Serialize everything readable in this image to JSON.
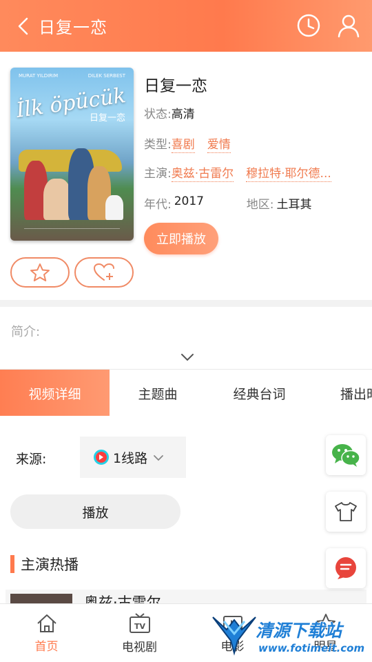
{
  "header": {
    "title": "日复一恋"
  },
  "poster": {
    "title_text": "İlk öpücük",
    "subtitle_text": "日复一恋",
    "name_left": "MURAT YILDIRIM",
    "name_right": "DILEK SERBEST"
  },
  "info": {
    "title": "日复一恋",
    "status_label": "状态:",
    "status_value": "高清",
    "genre_label": "类型:",
    "genres": [
      "喜剧",
      "爱情"
    ],
    "cast_label": "主演:",
    "cast": [
      "奥兹·古雷尔",
      "穆拉特·耶尔德..."
    ],
    "year_label": "年代:",
    "year_value": "2017",
    "region_label": "地区:",
    "region_value": "土耳其",
    "play_now": "立即播放"
  },
  "intro": {
    "label": "简介:"
  },
  "tabs": [
    "视频详细",
    "主题曲",
    "经典台词",
    "播出时"
  ],
  "source": {
    "label": "来源:",
    "selected": "1线路"
  },
  "play_button": "播放",
  "hot_section": {
    "title": "主演热播",
    "first_actor": "奥兹·古雷尔"
  },
  "bottom_nav": [
    {
      "label": "首页",
      "active": true
    },
    {
      "label": "电视剧",
      "active": false
    },
    {
      "label": "电影",
      "active": false
    },
    {
      "label": "明星",
      "active": false
    }
  ],
  "watermark": {
    "line1": "清源下载站",
    "line2": "www.fotimeit.com"
  },
  "colors": {
    "accent": "#ff7a4d",
    "tag": "#f07a4e",
    "wechat": "#47b34a",
    "chat": "#e8453c"
  }
}
